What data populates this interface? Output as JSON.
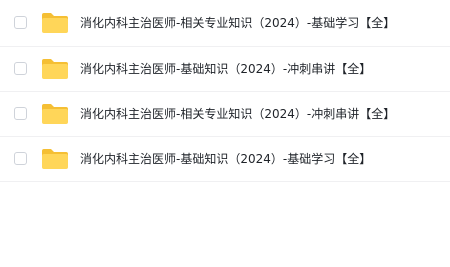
{
  "files": [
    {
      "name": "消化内科主治医师-相关专业知识（2024）-基础学习【全】",
      "icon": "folder-icon"
    },
    {
      "name": "消化内科主治医师-基础知识（2024）-冲刺串讲【全】",
      "icon": "folder-icon"
    },
    {
      "name": "消化内科主治医师-相关专业知识（2024）-冲刺串讲【全】",
      "icon": "folder-icon"
    },
    {
      "name": "消化内科主治医师-基础知识（2024）-基础学习【全】",
      "icon": "folder-icon"
    }
  ],
  "colors": {
    "folder_front": "#ffd659",
    "folder_back": "#f5bf34",
    "text": "#1f2329",
    "row_divider": "#f0f0f2"
  }
}
